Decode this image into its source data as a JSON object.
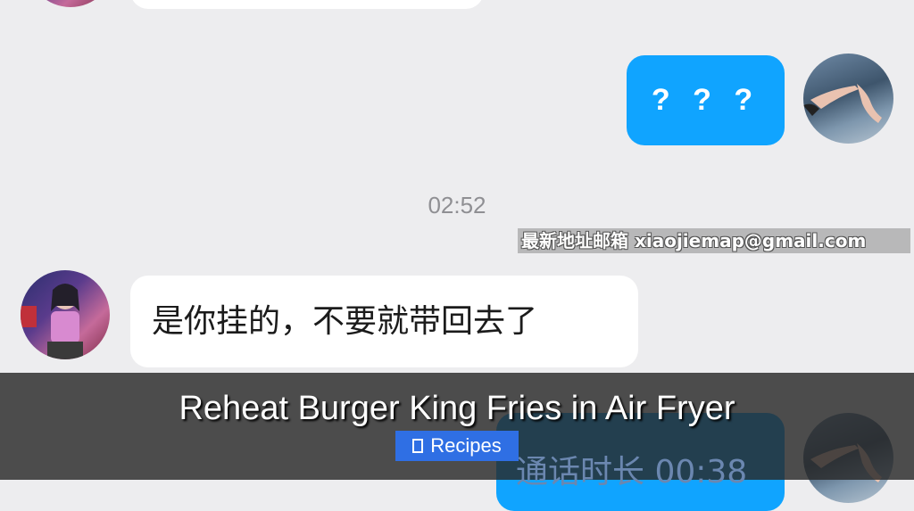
{
  "chat": {
    "outgoing_message_1": "? ? ?",
    "timestamp": "02:52",
    "incoming_message_1": "是你挂的，不要就带回去了",
    "call_message": "通话时长 00:38"
  },
  "watermark": {
    "text": "最新地址邮箱 xiaojiemap@gmail.com"
  },
  "overlay": {
    "title": "Reheat Burger King Fries in Air Fryer",
    "button_label": "Recipes",
    "button_icon": "book-icon"
  },
  "colors": {
    "background": "#ededef",
    "outgoing_bubble": "#10a4ff",
    "incoming_bubble": "#ffffff",
    "recipes_button": "#2f6fe4"
  }
}
